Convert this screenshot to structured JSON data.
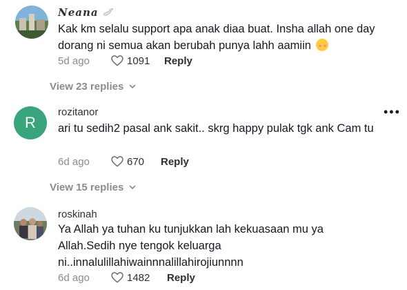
{
  "comments": [
    {
      "username": "𝑵𝒆𝒂𝒏𝒂",
      "username_suffix_icon": "dove-icon",
      "text": "Kak km selalu support apa anak diaa buat. Insha allah one day dorang ni semua akan berubah punya lahh aamiin",
      "text_emoji": "smiling-face-with-hearts-emoji",
      "time": "5d ago",
      "likes": "1091",
      "reply_label": "Reply",
      "view_replies": "View 23 replies"
    },
    {
      "username": "rozitanor",
      "avatar_letter": "R",
      "avatar_color": "#3aa57d",
      "text": "ari tu sedih2 pasal ank sakit.. skrg happy pulak tgk ank Cam tu",
      "time": "6d ago",
      "likes": "670",
      "reply_label": "Reply",
      "view_replies": "View 15 replies",
      "more_label": "•••"
    },
    {
      "username": "roskinah",
      "text": "Ya Allah ya tuhan ku tunjukkan lah kekuasaan mu ya Allah.Sedih nye tengok keluarga ni..innalulillahiwainnnalillahirojiunnnn",
      "time": "6d ago",
      "likes": "1482",
      "reply_label": "Reply"
    }
  ],
  "chevron_icon": "chevron-down-icon",
  "like_icon": "heart-outline-icon"
}
